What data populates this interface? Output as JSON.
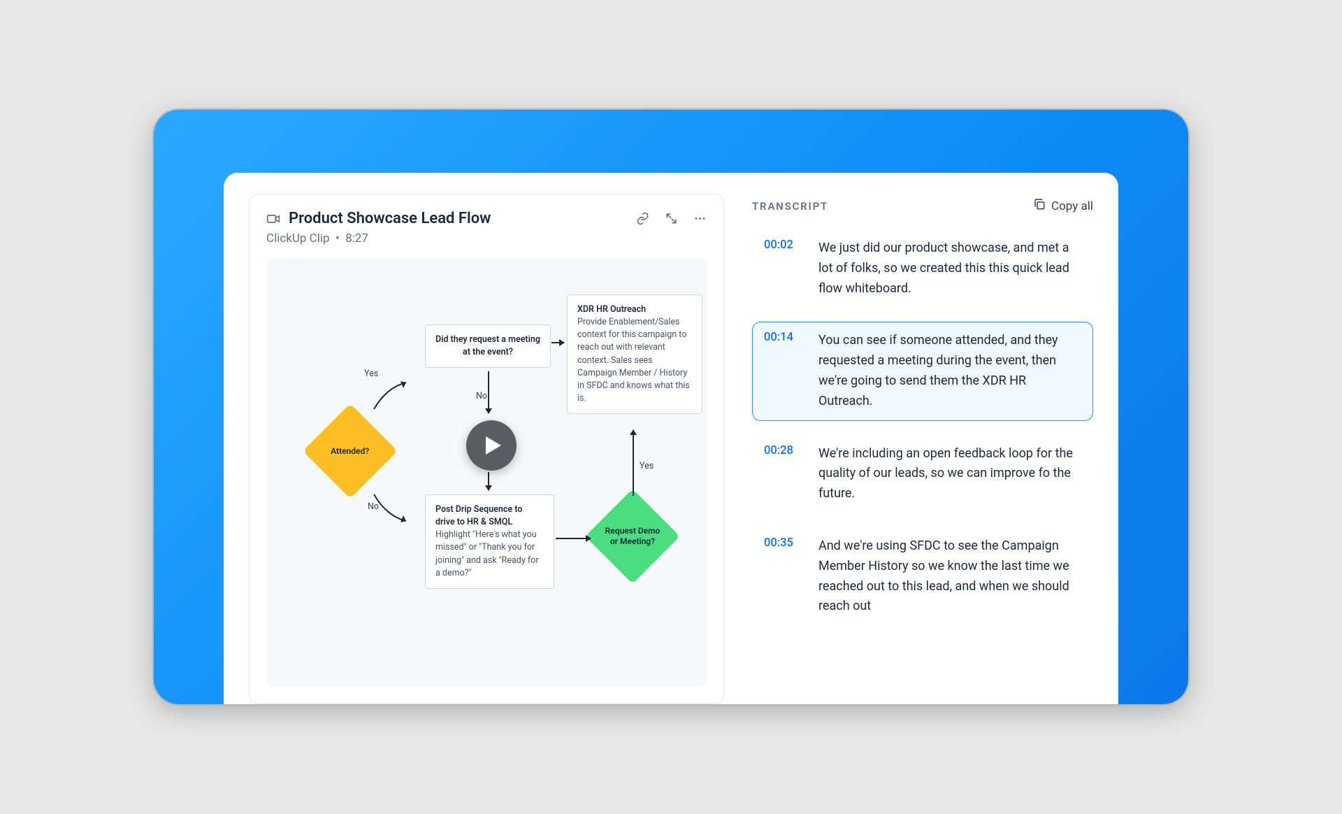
{
  "clip": {
    "title": "Product Showcase Lead Flow",
    "source": "ClickUp Clip",
    "duration": "8:27"
  },
  "whiteboard": {
    "attended": "Attended?",
    "yes": "Yes",
    "no": "No",
    "meeting_q": "Did they request a meeting at the event?",
    "xdr_title": "XDR HR Outreach",
    "xdr_body": "Provide Enablement/Sales context for this campaign to reach out with relevant context. Sales sees Campaign Member / History in SFDC and knows what this is.",
    "drip_title": "Post Drip Sequence to drive to HR & SMQL",
    "drip_body": "Highlight \"Here's what you missed\" or \"Thank you for joining\" and ask \"Ready for a demo?\"",
    "request_demo": "Request Demo or Meeting?"
  },
  "transcript": {
    "header": "TRANSCRIPT",
    "copy_all": "Copy all",
    "entries": [
      {
        "time": "00:02",
        "text": "We just did our product showcase, and met a lot of folks, so we created this this quick lead flow whiteboard.",
        "active": false
      },
      {
        "time": "00:14",
        "text": "You can see if someone attended, and they requested a meeting during the event, then we're going to send them the XDR HR Outreach.",
        "active": true
      },
      {
        "time": "00:28",
        "text": "We're including an open feedback loop for the quality of our leads, so we can improve fo the future.",
        "active": false
      },
      {
        "time": "00:35",
        "text": "And we're using SFDC to see the Campaign Member History so we know the last time we reached out to this lead, and when we should reach out",
        "active": false
      }
    ]
  }
}
